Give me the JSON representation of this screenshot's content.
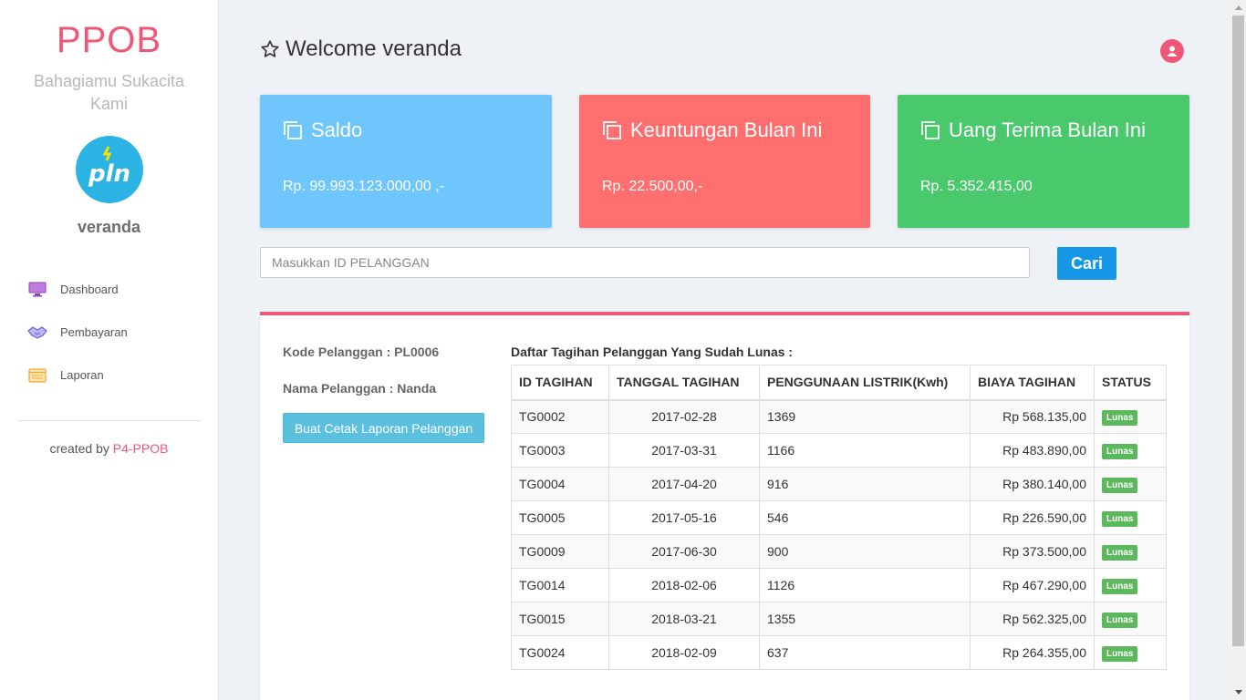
{
  "sidebar": {
    "brand": "PPOB",
    "tagline": "Bahagiamu Sukacita Kami",
    "logo_text": "pln",
    "username": "veranda",
    "nav": [
      {
        "label": "Dashboard",
        "icon": "monitor-icon"
      },
      {
        "label": "Pembayaran",
        "icon": "handshake-icon"
      },
      {
        "label": "Laporan",
        "icon": "report-icon"
      }
    ],
    "credit_prefix": "created by ",
    "credit_link": "P4-PPOB"
  },
  "header": {
    "welcome": "Welcome veranda"
  },
  "cards": [
    {
      "title": "Saldo",
      "value": "Rp. 99.993.123.000,00 ,-",
      "color": "#6ec6fc"
    },
    {
      "title": "Keuntungan Bulan Ini",
      "value": "Rp. 22.500,00,-",
      "color": "#ff6f6f"
    },
    {
      "title": "Uang Terima Bulan Ini",
      "value": "Rp. 5.352.415,00",
      "color": "#4ac86c"
    }
  ],
  "search": {
    "placeholder": "Masukkan ID PELANGGAN",
    "button": "Cari"
  },
  "customer": {
    "kode": "Kode Pelanggan : PL0006",
    "nama": "Nama Pelanggan : Nanda",
    "print_button": "Buat Cetak Laporan Pelanggan"
  },
  "bills": {
    "title": "Daftar Tagihan Pelanggan Yang Sudah Lunas :",
    "columns": [
      "ID TAGIHAN",
      "TANGGAL TAGIHAN",
      "PENGGUNAAN LISTRIK(Kwh)",
      "BIAYA TAGIHAN",
      "STATUS"
    ],
    "rows": [
      {
        "id": "TG0002",
        "date": "2017-02-28",
        "usage": "1369",
        "cost": "Rp 568.135,00",
        "status": "Lunas"
      },
      {
        "id": "TG0003",
        "date": "2017-03-31",
        "usage": "1166",
        "cost": "Rp 483.890,00",
        "status": "Lunas"
      },
      {
        "id": "TG0004",
        "date": "2017-04-20",
        "usage": "916",
        "cost": "Rp 380.140,00",
        "status": "Lunas"
      },
      {
        "id": "TG0005",
        "date": "2017-05-16",
        "usage": "546",
        "cost": "Rp 226.590,00",
        "status": "Lunas"
      },
      {
        "id": "TG0009",
        "date": "2017-06-30",
        "usage": "900",
        "cost": "Rp 373.500,00",
        "status": "Lunas"
      },
      {
        "id": "TG0014",
        "date": "2018-02-06",
        "usage": "1126",
        "cost": "Rp 467.290,00",
        "status": "Lunas"
      },
      {
        "id": "TG0015",
        "date": "2018-03-21",
        "usage": "1355",
        "cost": "Rp 562.325,00",
        "status": "Lunas"
      },
      {
        "id": "TG0024",
        "date": "2018-02-09",
        "usage": "637",
        "cost": "Rp 264.355,00",
        "status": "Lunas"
      }
    ]
  },
  "colors": {
    "accent": "#ef5777",
    "primary_button": "#1596e6",
    "info_button": "#5bc0de",
    "badge": "#5cb85c"
  }
}
